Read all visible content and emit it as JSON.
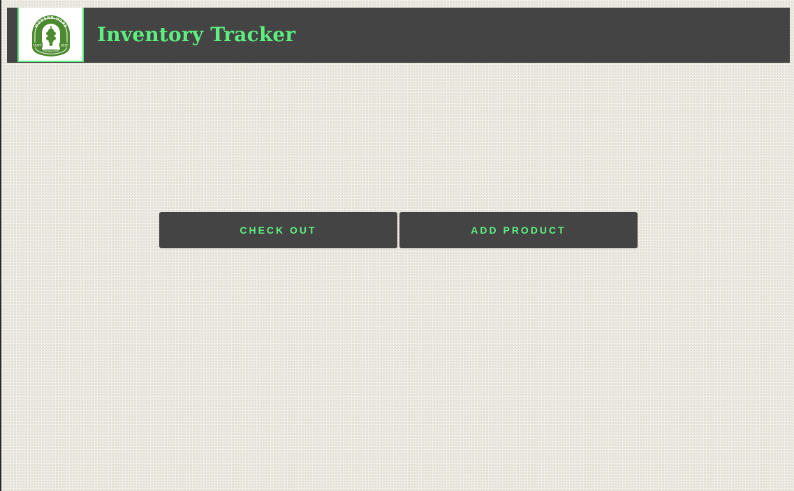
{
  "header": {
    "title": "Inventory Tracker",
    "logo": {
      "icon": "modern-hops-logo",
      "text_top": "MODERN HOPS",
      "text_left": "CRAFT",
      "text_right": "BEER",
      "text_bottom": "DISTRIBUTION"
    }
  },
  "actions": {
    "checkout_label": "CHECK OUT",
    "add_product_label": "ADD PRODUCT"
  },
  "colors": {
    "accent": "#5ef07f",
    "bar": "#444444",
    "logo_green": "#4c8a2f",
    "background": "#f4f2ec"
  }
}
